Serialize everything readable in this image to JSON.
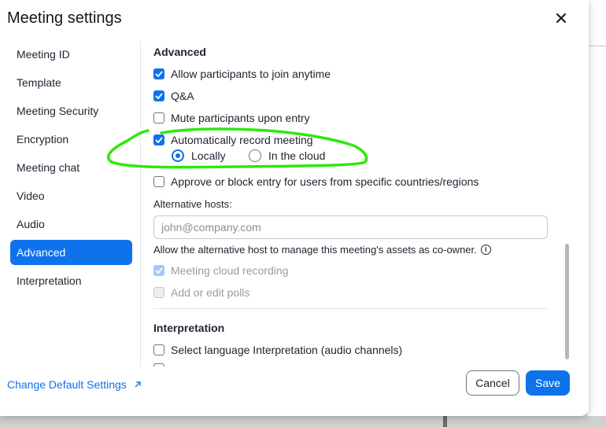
{
  "dialog": {
    "title": "Meeting settings",
    "close_icon": "close-icon"
  },
  "sidebar": {
    "items": [
      {
        "label": "Meeting ID",
        "active": false
      },
      {
        "label": "Template",
        "active": false
      },
      {
        "label": "Meeting Security",
        "active": false
      },
      {
        "label": "Encryption",
        "active": false
      },
      {
        "label": "Meeting chat",
        "active": false
      },
      {
        "label": "Video",
        "active": false
      },
      {
        "label": "Audio",
        "active": false
      },
      {
        "label": "Advanced",
        "active": true
      },
      {
        "label": "Interpretation",
        "active": false
      }
    ]
  },
  "advanced": {
    "heading": "Advanced",
    "allow_join_anytime": {
      "label": "Allow participants to join anytime",
      "checked": true
    },
    "qa": {
      "label": "Q&A",
      "checked": true
    },
    "mute_on_entry": {
      "label": "Mute participants upon entry",
      "checked": false
    },
    "auto_record": {
      "label": "Automatically record meeting",
      "checked": true,
      "options": [
        {
          "label": "Locally",
          "selected": true
        },
        {
          "label": "In the cloud",
          "selected": false
        }
      ]
    },
    "approve_block": {
      "label": "Approve or block entry for users from specific countries/regions",
      "checked": false
    },
    "alt_hosts": {
      "label": "Alternative hosts:",
      "value": "",
      "placeholder": "john@company.com",
      "note": "Allow the alternative host to manage this meeting's assets as co-owner.",
      "note_icon": "info-icon"
    },
    "cloud_recording": {
      "label": "Meeting cloud recording",
      "checked": true,
      "disabled": true
    },
    "edit_polls": {
      "label": "Add or edit polls",
      "checked": false,
      "disabled": true
    }
  },
  "interpretation": {
    "heading": "Interpretation",
    "language": {
      "label": "Select language Interpretation (audio channels)",
      "checked": false
    }
  },
  "footer": {
    "change_default_label": "Change Default Settings",
    "external_icon": "external-link-icon",
    "cancel_label": "Cancel",
    "save_label": "Save"
  },
  "colors": {
    "accent": "#0e72ed",
    "annotation_green": "#2ee80e"
  }
}
